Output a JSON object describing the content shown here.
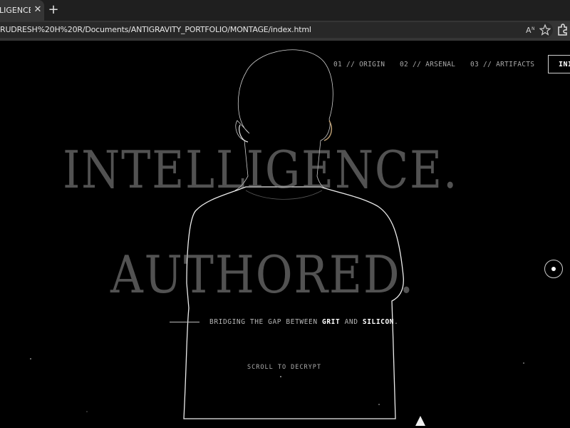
{
  "browser": {
    "tab_title": "LIGENCE AU",
    "tab_close": "✕",
    "new_tab": "+",
    "url": "RUDRESH%20H%20R/Documents/ANTIGRAVITY_PORTFOLIO/MONTAGE/index.html",
    "icons": [
      "read-aloud-icon",
      "favorite-star-icon",
      "extensions-icon"
    ]
  },
  "nav": {
    "items": [
      {
        "label": "01 // ORIGIN"
      },
      {
        "label": "02 // ARSENAL"
      },
      {
        "label": "03 // ARTIFACTS"
      }
    ],
    "cta_label": "INI"
  },
  "hero": {
    "line1": "INTELLIGENCE.",
    "line2": "AUTHORED.",
    "tagline_prefix": "BRIDGING THE GAP BETWEEN ",
    "tagline_word1": "GRIT",
    "tagline_and": " AND ",
    "tagline_word2": "SILICON",
    "tagline_suffix": ".",
    "scroll_cue": "SCROLL TO DECRYPT"
  },
  "colors": {
    "background": "#000000",
    "headline": "#8c8c8c",
    "rim_light": "#ffffff"
  }
}
